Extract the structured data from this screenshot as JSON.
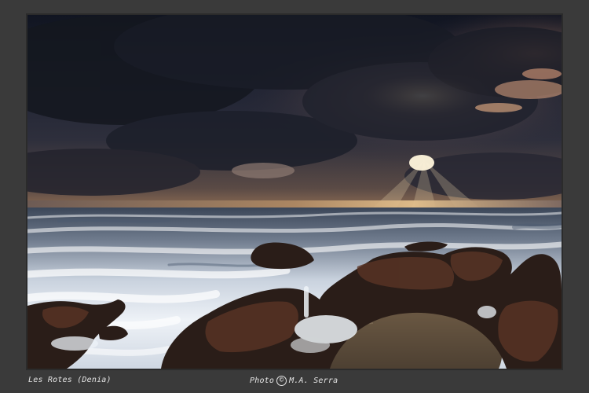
{
  "photo": {
    "location_caption": "Les Rotes (Denia)",
    "credit_prefix": "Photo",
    "credit_name": "M.A. Serra",
    "copyright_icon": "copyright-icon"
  },
  "colors": {
    "page_background": "#3a3a3a",
    "caption_text": "#e6e6e6",
    "sky_dark": "#1a1d2a",
    "sunburst": "#f6e3b6"
  }
}
